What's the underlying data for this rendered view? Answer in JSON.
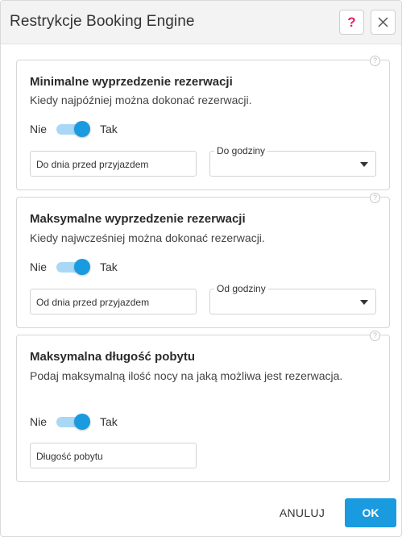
{
  "dialog": {
    "title": "Restrykcje Booking Engine",
    "help_label": "?"
  },
  "sections": [
    {
      "title": "Minimalne wyprzedzenie rezerwacji",
      "description": "Kiedy najpóźniej można dokonać rezerwacji.",
      "toggle_off_label": "Nie",
      "toggle_on_label": "Tak",
      "toggle_on": true,
      "input_value": "Do dnia przed przyjazdem",
      "select_label": "Do godziny",
      "select_value": ""
    },
    {
      "title": "Maksymalne wyprzedzenie rezerwacji",
      "description": "Kiedy najwcześniej można dokonać rezerwacji.",
      "toggle_off_label": "Nie",
      "toggle_on_label": "Tak",
      "toggle_on": true,
      "input_value": "Od dnia przed przyjazdem",
      "select_label": "Od godziny",
      "select_value": ""
    },
    {
      "title": "Maksymalna długość pobytu",
      "description": "Podaj maksymalną ilość nocy na jaką możliwa jest rezerwacja.",
      "toggle_off_label": "Nie",
      "toggle_on_label": "Tak",
      "toggle_on": true,
      "input_value": "Długość pobytu"
    }
  ],
  "footer": {
    "cancel_label": "ANULUJ",
    "ok_label": "OK"
  },
  "colors": {
    "accent": "#1a9be0",
    "help_icon": "#e91e63"
  }
}
